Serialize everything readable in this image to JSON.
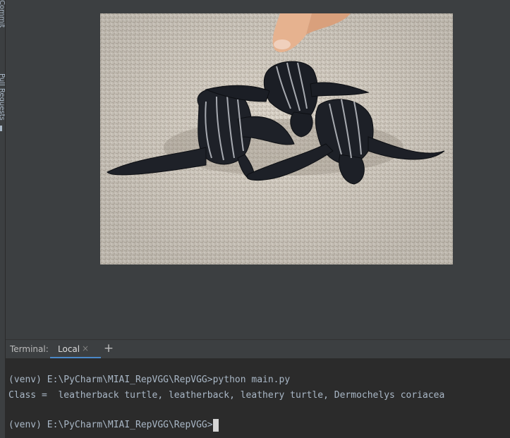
{
  "left_strip": {
    "commit_label": "Commit",
    "pull_requests_label": "Pull Requests"
  },
  "image": {
    "icon": "photo-of-leatherback-turtle-hatchlings"
  },
  "terminal": {
    "title": "Terminal:",
    "tabs": [
      {
        "label": "Local",
        "close_icon": "×"
      }
    ],
    "add_tab_icon": "+",
    "lines": [
      "(venv) E:\\PyCharm\\MIAI_RepVGG\\RepVGG>python main.py",
      "Class =  leatherback turtle, leatherback, leathery turtle, Dermochelys coriacea",
      "(venv) E:\\PyCharm\\MIAI_RepVGG\\RepVGG>"
    ]
  },
  "colors": {
    "background": "#3c3f41",
    "terminal_bg": "#2b2b2b",
    "terminal_text": "#a9b7c6",
    "tab_accent": "#4a88c7"
  }
}
